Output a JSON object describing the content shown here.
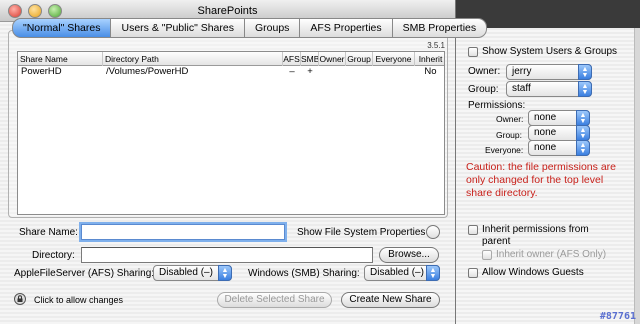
{
  "window": {
    "title": "SharePoints"
  },
  "tabs": [
    {
      "label": "\"Normal\" Shares",
      "active": true
    },
    {
      "label": "Users & \"Public\" Shares",
      "active": false
    },
    {
      "label": "Groups",
      "active": false
    },
    {
      "label": "AFS Properties",
      "active": false
    },
    {
      "label": "SMB Properties",
      "active": false
    }
  ],
  "version": "3.5.1",
  "table": {
    "columns": [
      "Share Name",
      "Directory Path",
      "AFS",
      "SMB",
      "Owner",
      "Group",
      "Everyone",
      "Inherit"
    ],
    "rows": [
      {
        "share_name": "PowerHD",
        "directory_path": "/Volumes/PowerHD",
        "afs": "–",
        "smb": "+",
        "owner": "",
        "group": "",
        "everyone": "",
        "inherit": "No"
      }
    ]
  },
  "form": {
    "share_name_label": "Share Name:",
    "share_name_value": "",
    "show_fs_props_label": "Show File System Properties",
    "directory_label": "Directory:",
    "directory_value": "",
    "browse_label": "Browse...",
    "afs_label": "AppleFileServer (AFS) Sharing:",
    "afs_value": "Disabled (–)",
    "smb_label": "Windows (SMB) Sharing:",
    "smb_value": "Disabled (–)"
  },
  "footer": {
    "lock_label": "Click to allow changes",
    "delete_label": "Delete Selected Share",
    "create_label": "Create New Share"
  },
  "drawer": {
    "show_system_label": "Show System Users & Groups",
    "owner_label": "Owner:",
    "owner_value": "jerry",
    "group_label": "Group:",
    "group_value": "staff",
    "permissions_label": "Permissions:",
    "perm_owner_label": "Owner:",
    "perm_owner_value": "none",
    "perm_group_label": "Group:",
    "perm_group_value": "none",
    "perm_everyone_label": "Everyone:",
    "perm_everyone_value": "none",
    "caution": "Caution: the file permissions are only changed for the top level share directory.",
    "inherit_label_1": "Inherit permissions from",
    "inherit_label_2": "parent",
    "inherit_owner_label": "Inherit owner (AFS Only)",
    "allow_guests_label": "Allow Windows Guests"
  },
  "watermark": "#87761",
  "colors": {
    "accent": "#4a8ee6",
    "caution": "#c8201a"
  }
}
